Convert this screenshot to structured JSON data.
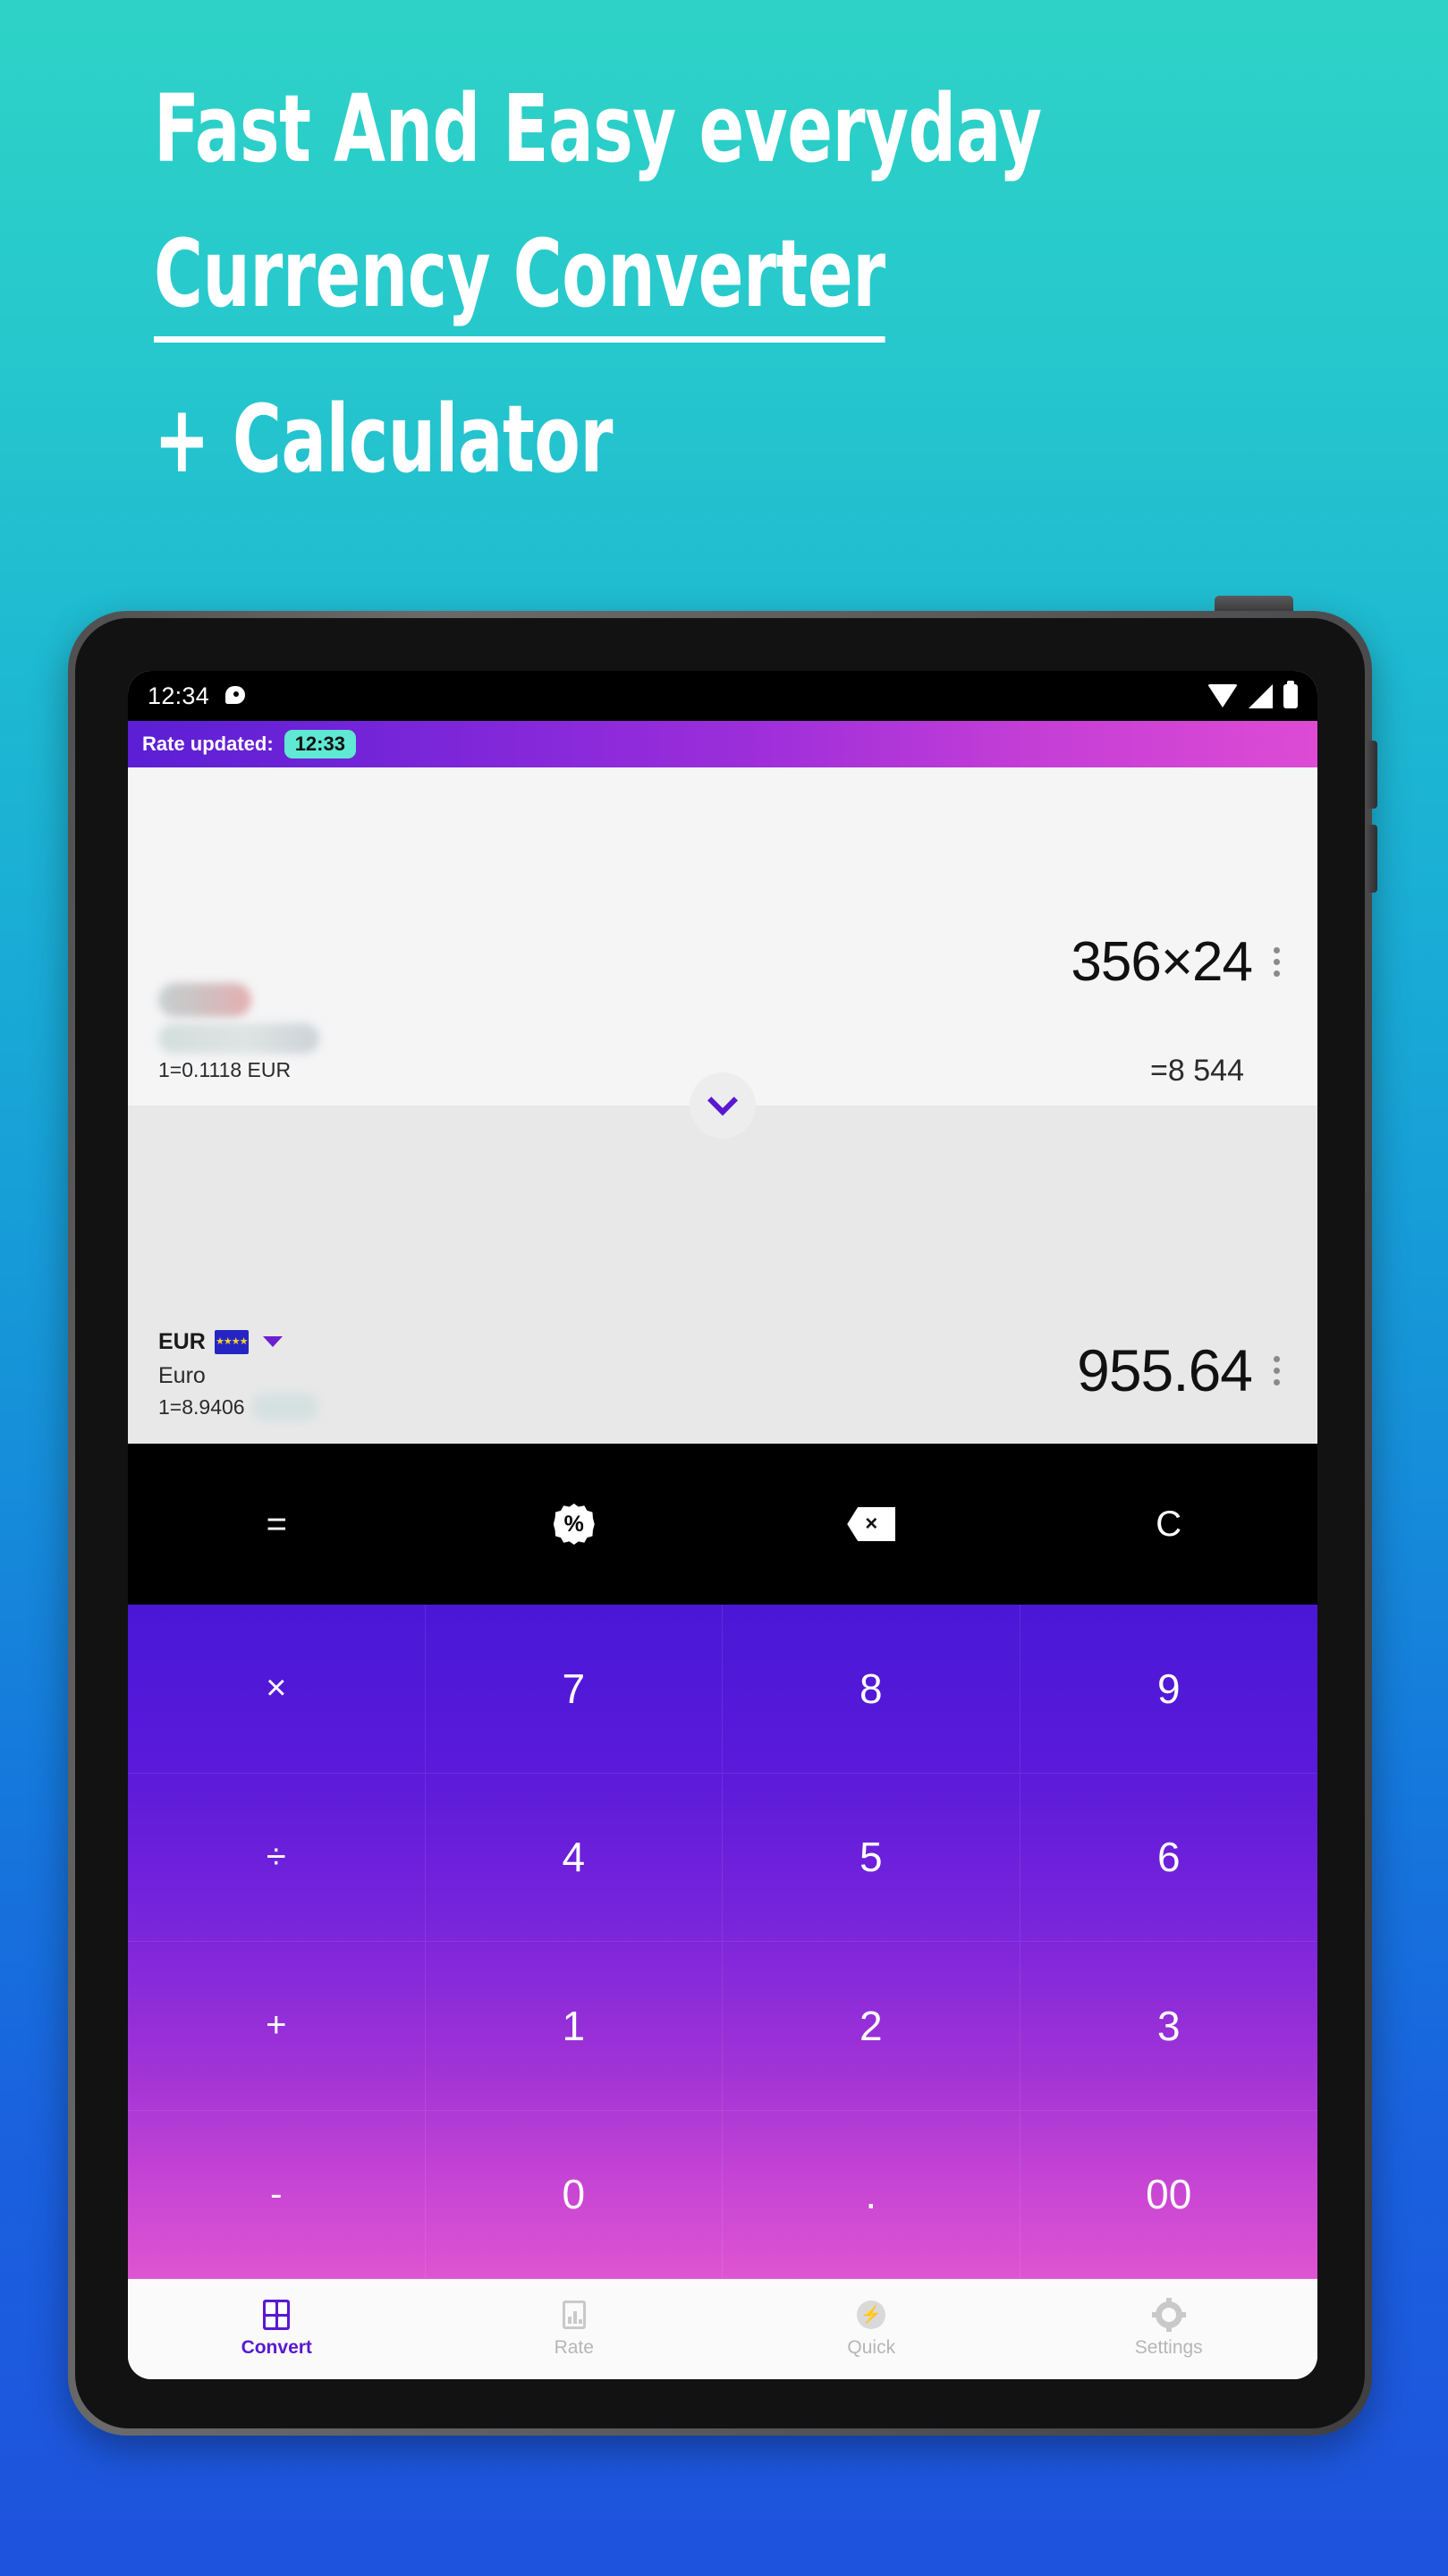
{
  "promo": {
    "line1": "Fast And Easy everyday",
    "line2": "Currency Converter",
    "line3": "+ Calculator"
  },
  "colors": {
    "bg_top": "#2ED3C6",
    "bg_bottom": "#1E53DD",
    "accent_purple": "#5A18D2",
    "badge_teal": "#5FE8D3",
    "topbar_from": "#5B1FD4",
    "topbar_to": "#DE55D2",
    "keypad_from": "#4A17D6",
    "keypad_to": "#DE55D2"
  },
  "statusbar": {
    "time": "12:34",
    "chat_icon": "chat-bubble-icon",
    "wifi_icon": "wifi-icon",
    "signal_icon": "signal-icon",
    "battery_icon": "battery-icon"
  },
  "ratebar": {
    "label": "Rate updated:",
    "time_badge": "12:33"
  },
  "converter": {
    "from": {
      "expression": "356×24",
      "result": "=8 544",
      "rate_text": "1=0.1118 EUR",
      "code_redacted": true,
      "name_redacted": true,
      "menu_icon": "kebab-menu-icon"
    },
    "to": {
      "amount": "955.64",
      "code": "EUR",
      "flag": "eu-flag-icon",
      "name": "Euro",
      "rate_text": "1=8.9406",
      "rate_suffix_redacted": true,
      "dropdown_icon": "caret-down-icon",
      "menu_icon": "kebab-menu-icon"
    },
    "swap_icon": "chevron-down-icon"
  },
  "functions": [
    {
      "label": "=",
      "name": "equals-button",
      "icon": "none"
    },
    {
      "label": "%",
      "name": "percent-button",
      "icon": "percent-badge-icon"
    },
    {
      "label": "×",
      "name": "backspace-button",
      "icon": "backspace-icon"
    },
    {
      "label": "C",
      "name": "clear-button",
      "icon": "none"
    }
  ],
  "keypad": [
    {
      "label": "×",
      "name": "key-multiply",
      "type": "op"
    },
    {
      "label": "7",
      "name": "key-7",
      "type": "num"
    },
    {
      "label": "8",
      "name": "key-8",
      "type": "num"
    },
    {
      "label": "9",
      "name": "key-9",
      "type": "num"
    },
    {
      "label": "÷",
      "name": "key-divide",
      "type": "op"
    },
    {
      "label": "4",
      "name": "key-4",
      "type": "num"
    },
    {
      "label": "5",
      "name": "key-5",
      "type": "num"
    },
    {
      "label": "6",
      "name": "key-6",
      "type": "num"
    },
    {
      "label": "+",
      "name": "key-plus",
      "type": "op"
    },
    {
      "label": "1",
      "name": "key-1",
      "type": "num"
    },
    {
      "label": "2",
      "name": "key-2",
      "type": "num"
    },
    {
      "label": "3",
      "name": "key-3",
      "type": "num"
    },
    {
      "label": "-",
      "name": "key-minus",
      "type": "op"
    },
    {
      "label": "0",
      "name": "key-0",
      "type": "num"
    },
    {
      "label": ".",
      "name": "key-decimal",
      "type": "num"
    },
    {
      "label": "00",
      "name": "key-double-zero",
      "type": "num"
    }
  ],
  "bottom_nav": [
    {
      "label": "Convert",
      "icon": "calculator-icon",
      "active": true
    },
    {
      "label": "Rate",
      "icon": "chart-icon",
      "active": false
    },
    {
      "label": "Quick",
      "icon": "flash-circle-icon",
      "active": false
    },
    {
      "label": "Settings",
      "icon": "gear-icon",
      "active": false
    }
  ]
}
